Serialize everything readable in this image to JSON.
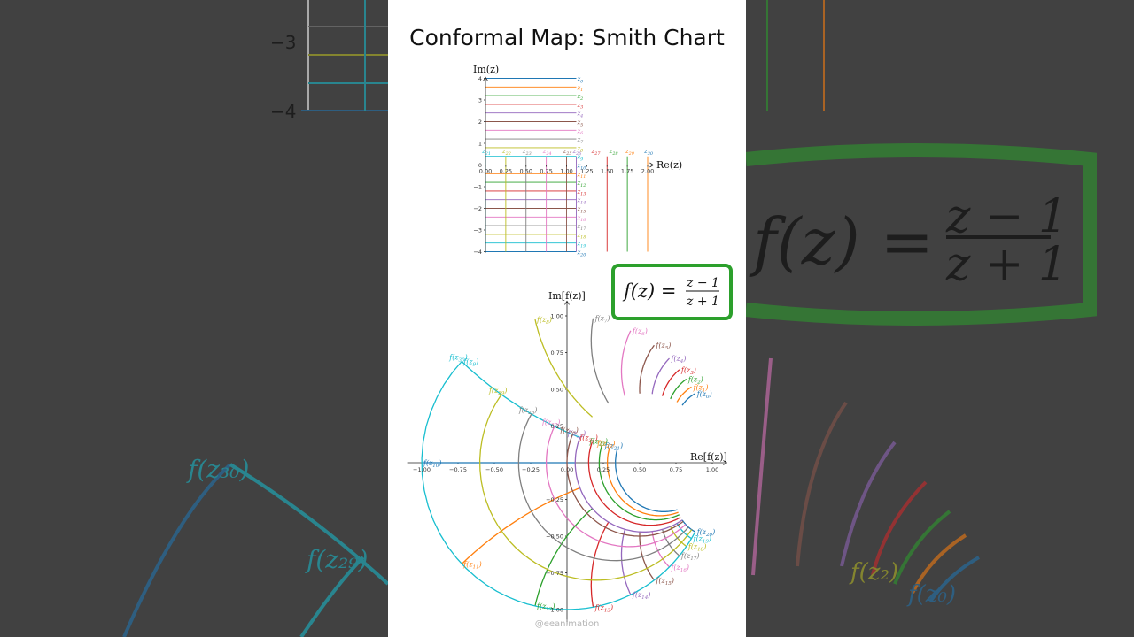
{
  "title": "Conformal Map: Smith Chart",
  "formula": {
    "lhs": "f(z) =",
    "numerator": "z − 1",
    "denominator": "z + 1"
  },
  "watermark": "@eeanimation",
  "chart_data": [
    {
      "type": "line",
      "name": "z-plane grid",
      "xlabel": "Re(z)",
      "ylabel": "Im(z)",
      "xlim": [
        0,
        2
      ],
      "ylim": [
        -4,
        4
      ],
      "xticks": [
        "0.00",
        "0.25",
        "0.50",
        "0.75",
        "1.00",
        "1.25",
        "1.50",
        "1.75",
        "2.00"
      ],
      "yticks": [
        "4",
        "3",
        "2",
        "1",
        "0",
        "−1",
        "−2",
        "−3",
        "−4"
      ],
      "horizontal_lines": {
        "y": [
          4.0,
          3.6,
          3.2,
          2.8,
          2.4,
          2.0,
          1.6,
          1.2,
          0.8,
          0.4,
          0.0,
          -0.4,
          -0.8,
          -1.2,
          -1.6,
          -2.0,
          -2.4,
          -2.8,
          -3.2,
          -3.6,
          -4.0
        ],
        "x_range": [
          0,
          1.25
        ],
        "labels": [
          "z0",
          "z1",
          "z2",
          "z3",
          "z4",
          "z5",
          "z6",
          "z7",
          "z8",
          "z9",
          "z10",
          "z11",
          "z12",
          "z13",
          "z14",
          "z15",
          "z16",
          "z17",
          "z18",
          "z19",
          "z20"
        ]
      },
      "vertical_lines": {
        "x": [
          0.0,
          0.25,
          0.5,
          0.75,
          1.0,
          1.25,
          1.5,
          1.75,
          2.0
        ],
        "x_labels": [
          0.0,
          0.25,
          0.5,
          0.75,
          1.0,
          1.12,
          1.5,
          1.75,
          2.0
        ],
        "y_range": [
          -4,
          0.4
        ],
        "labels": [
          "z30",
          "z29",
          "z28",
          "z27",
          "z26",
          "z25",
          "z24",
          "z23",
          "z22",
          "z21"
        ]
      }
    },
    {
      "type": "line",
      "name": "w-plane (Smith chart)",
      "xlabel": "Re[f(z)]",
      "ylabel": "Im[f(z)]",
      "xlim": [
        -1,
        1
      ],
      "ylim": [
        -1,
        1
      ],
      "xticks": [
        "−1.00",
        "−0.75",
        "−0.50",
        "−0.25",
        "0.00",
        "0.25",
        "0.50",
        "0.75",
        "1.00"
      ],
      "yticks": [
        "1.00",
        "0.75",
        "0.50",
        "0.25",
        "0.00",
        "−0.25",
        "−0.50",
        "−0.75",
        "−1.00"
      ],
      "mapping": "f(z) = (z − 1)/(z + 1)",
      "curve_labels": [
        "f(z0)",
        "f(z1)",
        "f(z2)",
        "f(z3)",
        "f(z4)",
        "f(z5)",
        "f(z6)",
        "f(z7)",
        "f(z8)",
        "f(z9)",
        "f(z10)",
        "f(z11)",
        "f(z12)",
        "f(z13)",
        "f(z14)",
        "f(z15)",
        "f(z16)",
        "f(z17)",
        "f(z18)",
        "f(z19)",
        "f(z20)",
        "f(z21)",
        "f(z22)",
        "f(z23)",
        "f(z24)",
        "f(z25)",
        "f(z26)",
        "f(z27)",
        "f(z28)",
        "f(z29)",
        "f(z30)"
      ]
    }
  ],
  "colors": [
    "#1f77b4",
    "#ff7f0e",
    "#2ca02c",
    "#d62728",
    "#9467bd",
    "#8c564b",
    "#e377c2",
    "#7f7f7f",
    "#bcbd22",
    "#17becf"
  ],
  "formula_border": "#2ca02c"
}
